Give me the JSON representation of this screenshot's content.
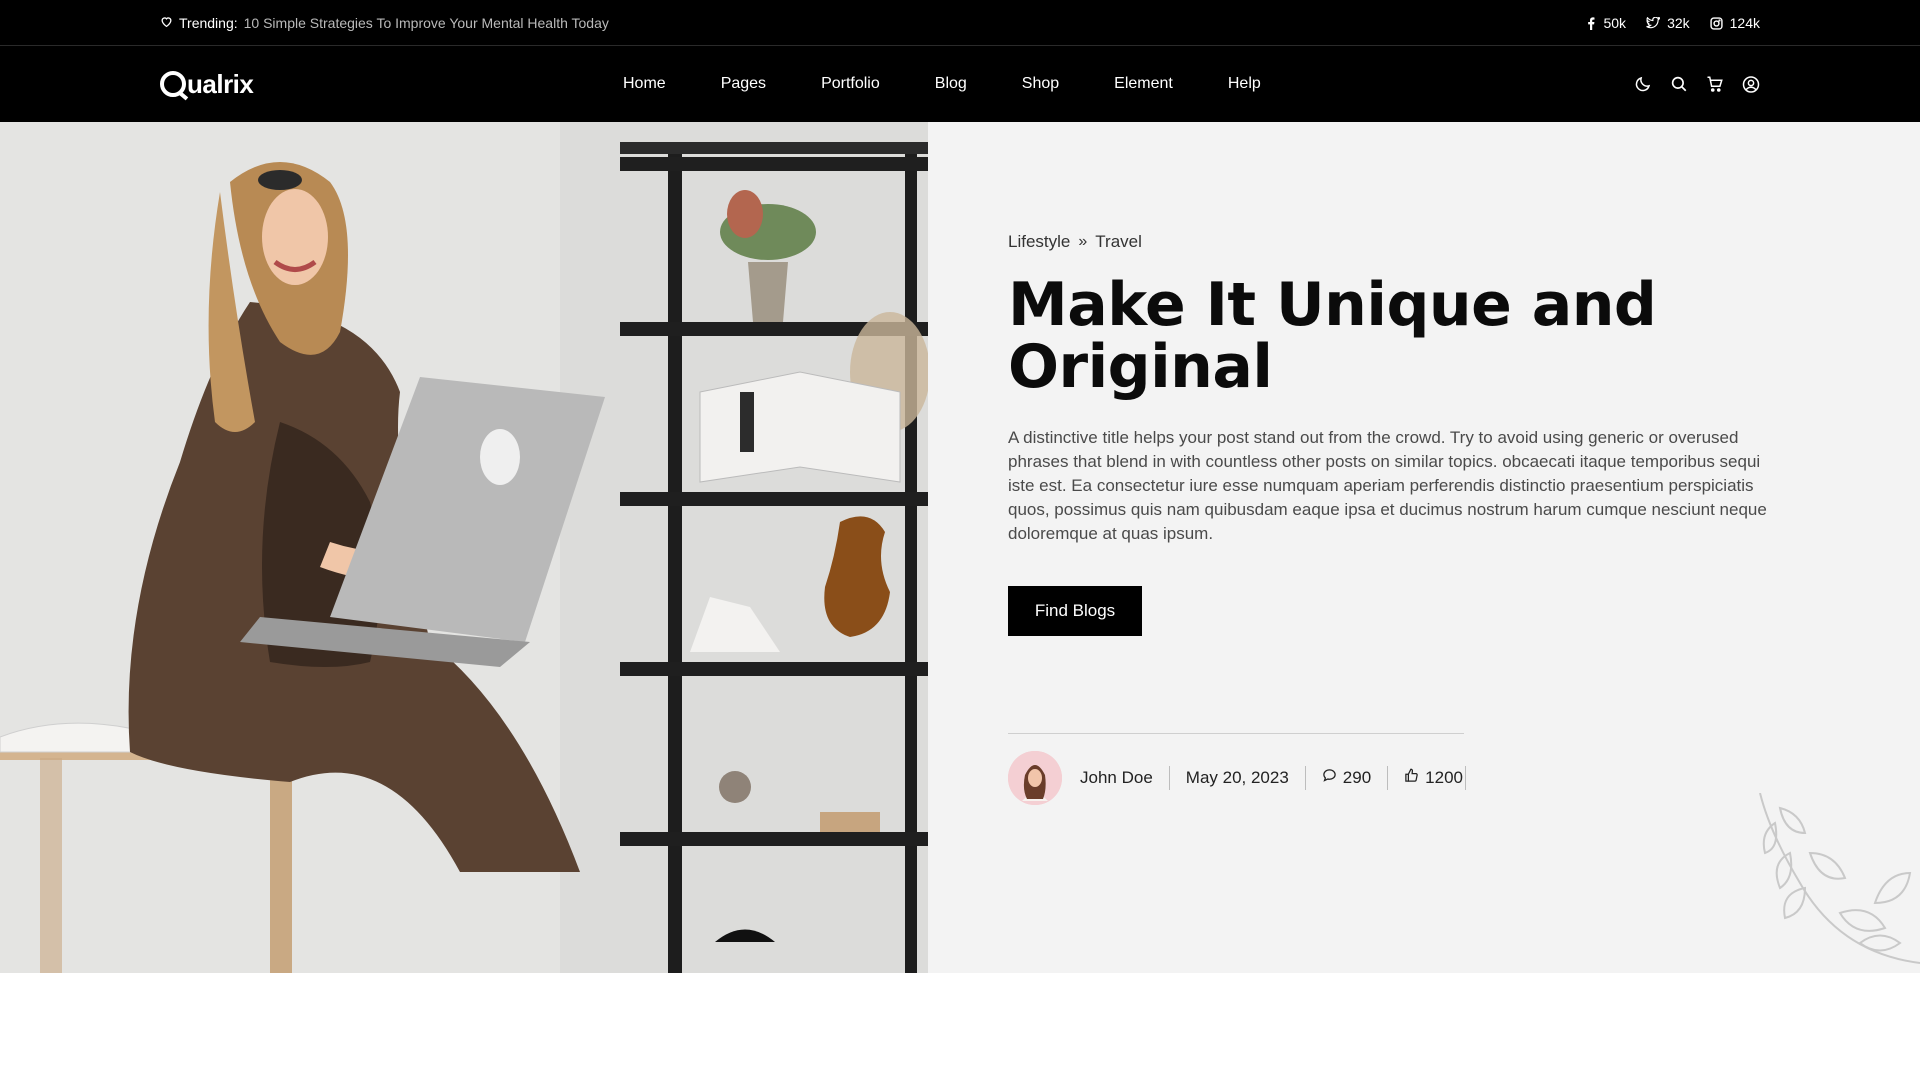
{
  "topbar": {
    "trending_label": "Trending:",
    "trending_headline": "10 Simple Strategies To Improve Your Mental Health Today",
    "socials": [
      {
        "icon": "facebook-icon",
        "count": "50k"
      },
      {
        "icon": "twitter-icon",
        "count": "32k"
      },
      {
        "icon": "instagram-icon",
        "count": "124k"
      }
    ]
  },
  "header": {
    "logo": "ualrix",
    "nav": [
      "Home",
      "Pages",
      "Portfolio",
      "Blog",
      "Shop",
      "Element",
      "Help"
    ],
    "icons": [
      "moon-icon",
      "search-icon",
      "cart-icon",
      "user-icon"
    ]
  },
  "hero": {
    "breadcrumb": [
      "Lifestyle",
      "Travel"
    ],
    "title": "Make It Unique and Original",
    "description": "A distinctive title helps your post stand out from the crowd. Try to avoid using generic or overused phrases that blend in with countless other posts on similar topics. obcaecati itaque temporibus sequi iste est. Ea consectetur iure esse numquam aperiam perferendis distinctio praesentium perspiciatis quos, possimus quis nam quibusdam eaque ipsa et ducimus nostrum harum cumque nesciunt neque doloremque at quas ipsum.",
    "button_label": "Find Blogs",
    "meta": {
      "author": "John Doe",
      "date": "May 20, 2023",
      "comments": "290",
      "likes": "1200"
    }
  },
  "colors": {
    "bar_bg": "#000000",
    "hero_bg": "#f3f3f3",
    "accent": "#000000"
  }
}
